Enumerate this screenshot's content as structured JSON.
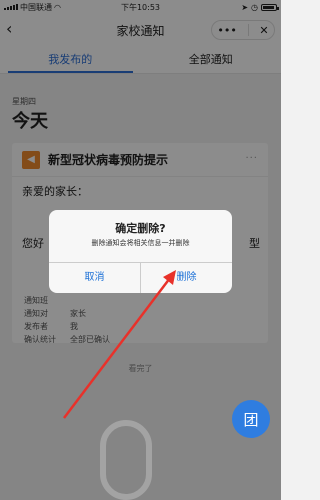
{
  "status_bar": {
    "carrier": "中国联通",
    "time": "下午10:53",
    "battery_level": 0.9
  },
  "nav": {
    "title": "家校通知",
    "more_icon": "•••",
    "close_icon": "✕"
  },
  "tabs": [
    {
      "label": "我发布的",
      "active": true
    },
    {
      "label": "全部通知",
      "active": false
    }
  ],
  "date_group": {
    "weekday": "星期四",
    "label": "今天"
  },
  "notice": {
    "title": "新型冠状病毒预防提示",
    "greeting": "亲爱的家长：",
    "body_start": "您好",
    "body_end": "型",
    "meta": [
      {
        "key": "通知班",
        "value": ""
      },
      {
        "key": "通知对",
        "value": "家长"
      },
      {
        "key": "发布者",
        "value": "我"
      },
      {
        "key": "确认统计",
        "value": "全部已确认"
      }
    ]
  },
  "footer": {
    "end_text": "看完了"
  },
  "fab": {
    "label": "团"
  },
  "dialog": {
    "title": "确定删除?",
    "message": "删除通知会将相关信息一并删除",
    "cancel": "取消",
    "confirm": "删除"
  },
  "colors": {
    "accent": "#2e6fd6",
    "arrow": "#e8312a",
    "notice_icon": "#ee8a2e"
  }
}
